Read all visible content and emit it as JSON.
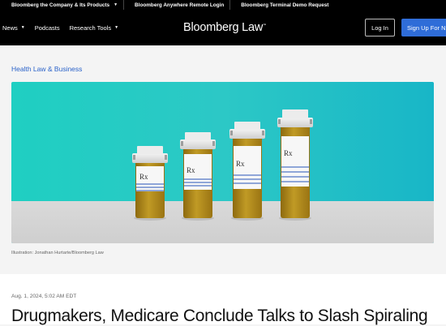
{
  "utility_bar": {
    "items": [
      "Bloomberg the Company & Its Products",
      "Bloomberg Anywhere Remote Login",
      "Bloomberg Terminal Demo Request"
    ]
  },
  "nav": {
    "links": [
      "News",
      "Podcasts",
      "Research Tools"
    ],
    "logo": "Bloomberg Law",
    "login": "Log In",
    "signup": "Sign Up For N"
  },
  "article": {
    "category": "Health Law & Business",
    "caption": "Illustration: Jonathan Hurtarte/Bloomberg Law",
    "date": "Aug. 1, 2024, 5:02 AM EDT",
    "headline": "Drugmakers, Medicare Conclude Talks to Slash Spiraling"
  },
  "illustration": {
    "bottle_label": "Rx",
    "colors": {
      "background": "#22c8c4",
      "floor": "#d6d6d6",
      "pill_fill": "#b08a1a",
      "label_stripe": "#8fa6d8"
    }
  }
}
